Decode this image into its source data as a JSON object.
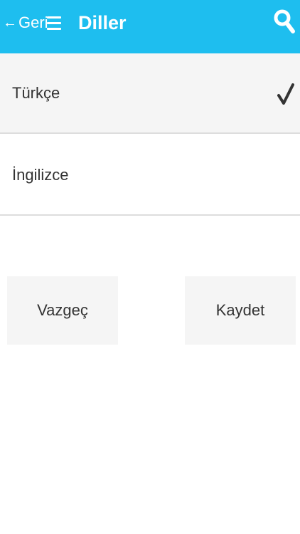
{
  "header": {
    "back_label": "Geri",
    "title": "Diller"
  },
  "languages": [
    {
      "label": "Türkçe",
      "selected": true
    },
    {
      "label": "İngilizce",
      "selected": false
    }
  ],
  "actions": {
    "cancel_label": "Vazgeç",
    "save_label": "Kaydet"
  },
  "icons": {
    "back": "arrow-left-icon",
    "menu": "hamburger-menu-icon",
    "search": "search-icon",
    "selected": "checkmark-icon"
  },
  "colors": {
    "header_bg": "#1ebeef",
    "header_text": "#ffffff",
    "selected_row_bg": "#f5f5f5",
    "button_bg": "#f5f5f5",
    "text": "#333333"
  }
}
